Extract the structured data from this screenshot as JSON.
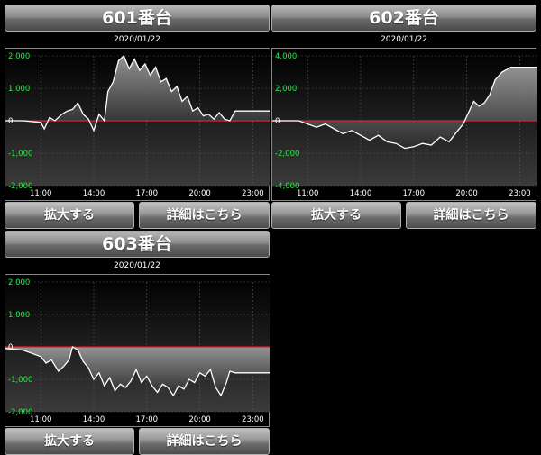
{
  "panels": [
    {
      "title": "601番台",
      "date": "2020/01/22",
      "zoom_label": "拡大する",
      "detail_label": "詳細はこちら",
      "chart_data": {
        "type": "area",
        "ylim": [
          -2000,
          2000
        ],
        "yticks": [
          "2,000",
          "1,000",
          "0",
          "-1,000",
          "-2,000"
        ],
        "ytick_values": [
          2000,
          1000,
          0,
          -1000,
          -2000
        ],
        "xticks": [
          "11:00",
          "14:00",
          "17:00",
          "20:00",
          "23:00"
        ],
        "xtick_values": [
          11,
          14,
          17,
          20,
          23
        ],
        "x": [
          9,
          10,
          11,
          11.2,
          11.5,
          11.8,
          12.2,
          12.5,
          12.8,
          13.1,
          13.4,
          13.7,
          14,
          14.3,
          14.6,
          14.8,
          15.1,
          15.4,
          15.7,
          16,
          16.3,
          16.6,
          16.9,
          17.2,
          17.5,
          17.8,
          18.1,
          18.4,
          18.7,
          19,
          19.3,
          19.6,
          19.9,
          20.2,
          20.5,
          20.8,
          21.1,
          21.4,
          21.7,
          22,
          23,
          24
        ],
        "values": [
          0,
          0,
          -50,
          -250,
          100,
          0,
          200,
          300,
          350,
          550,
          200,
          50,
          -300,
          200,
          0,
          900,
          1200,
          1850,
          2000,
          1600,
          1900,
          1550,
          1750,
          1400,
          1650,
          1200,
          1300,
          900,
          1050,
          600,
          750,
          300,
          400,
          150,
          200,
          50,
          250,
          50,
          0,
          300,
          300,
          300
        ]
      }
    },
    {
      "title": "602番台",
      "date": "2020/01/22",
      "zoom_label": "拡大する",
      "detail_label": "詳細はこちら",
      "chart_data": {
        "type": "area",
        "ylim": [
          -4000,
          4000
        ],
        "yticks": [
          "4,000",
          "2,000",
          "0",
          "-2,000",
          "-4,000"
        ],
        "ytick_values": [
          4000,
          2000,
          0,
          -2000,
          -4000
        ],
        "xticks": [
          "11:00",
          "14:00",
          "17:00",
          "20:00",
          "23:00"
        ],
        "xtick_values": [
          11,
          14,
          17,
          20,
          23
        ],
        "x": [
          9,
          10.5,
          11.5,
          12,
          12.5,
          13,
          13.5,
          14,
          14.5,
          15,
          15.5,
          16,
          16.5,
          17,
          17.5,
          18,
          18.5,
          19,
          19.5,
          19.8,
          20.1,
          20.4,
          20.7,
          21,
          21.3,
          21.6,
          22,
          22.5,
          23,
          24
        ],
        "values": [
          0,
          0,
          -400,
          -200,
          -500,
          -800,
          -600,
          -900,
          -1200,
          -900,
          -1300,
          -1400,
          -1700,
          -1600,
          -1400,
          -1500,
          -1000,
          -1300,
          -600,
          -200,
          500,
          1200,
          900,
          1100,
          1600,
          2500,
          3000,
          3300,
          3300,
          3300
        ]
      }
    },
    {
      "title": "603番台",
      "date": "2020/01/22",
      "zoom_label": "拡大する",
      "detail_label": "詳細はこちら",
      "chart_data": {
        "type": "area",
        "ylim": [
          -2000,
          2000
        ],
        "yticks": [
          "2,000",
          "1,000",
          "0",
          "-1,000",
          "-2,000"
        ],
        "ytick_values": [
          2000,
          1000,
          0,
          -1000,
          -2000
        ],
        "xticks": [
          "11:00",
          "14:00",
          "17:00",
          "20:00",
          "23:00"
        ],
        "xtick_values": [
          11,
          14,
          17,
          20,
          23
        ],
        "x": [
          9,
          10,
          10.5,
          11,
          11.3,
          11.6,
          12,
          12.3,
          12.6,
          12.8,
          13.1,
          13.4,
          13.7,
          14,
          14.3,
          14.6,
          14.9,
          15.2,
          15.5,
          15.8,
          16.1,
          16.4,
          16.7,
          17,
          17.3,
          17.6,
          17.9,
          18.2,
          18.5,
          18.8,
          19.1,
          19.4,
          19.7,
          20,
          20.3,
          20.6,
          20.9,
          21.2,
          21.5,
          21.7,
          22,
          23,
          24
        ],
        "values": [
          -50,
          -100,
          -200,
          -300,
          -500,
          -400,
          -750,
          -600,
          -400,
          0,
          -100,
          -450,
          -650,
          -1000,
          -800,
          -1200,
          -950,
          -1350,
          -1150,
          -1250,
          -1050,
          -700,
          -1100,
          -900,
          -1200,
          -1400,
          -1150,
          -1250,
          -1500,
          -1200,
          -1300,
          -1000,
          -1100,
          -800,
          -900,
          -700,
          -1250,
          -1500,
          -1100,
          -750,
          -800,
          -800,
          -800
        ]
      }
    }
  ]
}
